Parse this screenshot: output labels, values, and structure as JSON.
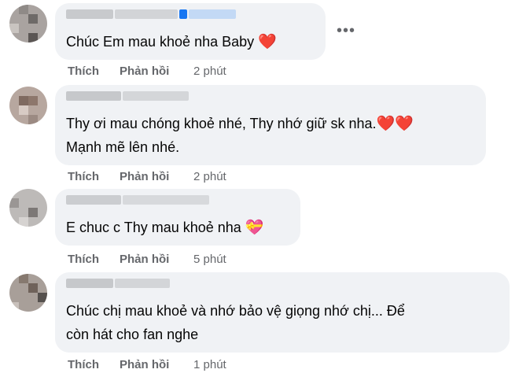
{
  "comments": [
    {
      "text_lines": [
        "Chúc Em mau khoẻ nha Baby"
      ],
      "emoji": "❤️",
      "like": "Thích",
      "reply": "Phản hồi",
      "time": "2 phút",
      "has_more": true
    },
    {
      "text_lines": [
        "Thy ơi mau chóng khoẻ nhé, Thy nhớ giữ sk nha.",
        "Mạnh mẽ lên nhé."
      ],
      "emoji": "❤️❤️",
      "like": "Thích",
      "reply": "Phản hồi",
      "time": "2 phút"
    },
    {
      "text_lines": [
        "E chuc c Thy mau khoẻ nha"
      ],
      "emoji": "💝",
      "like": "Thích",
      "reply": "Phản hồi",
      "time": "5 phút"
    },
    {
      "text_lines": [
        "Chúc chị mau khoẻ và nhớ bảo vệ giọng nhớ chị... Để",
        "còn hát cho fan nghe"
      ],
      "like": "Thích",
      "reply": "Phản hồi",
      "time": "1 phút"
    }
  ],
  "more_icon": "more-horizontal-icon",
  "colors": {
    "bubble": "#f0f2f5",
    "meta": "#65676b",
    "heart": "#e41e3f"
  }
}
